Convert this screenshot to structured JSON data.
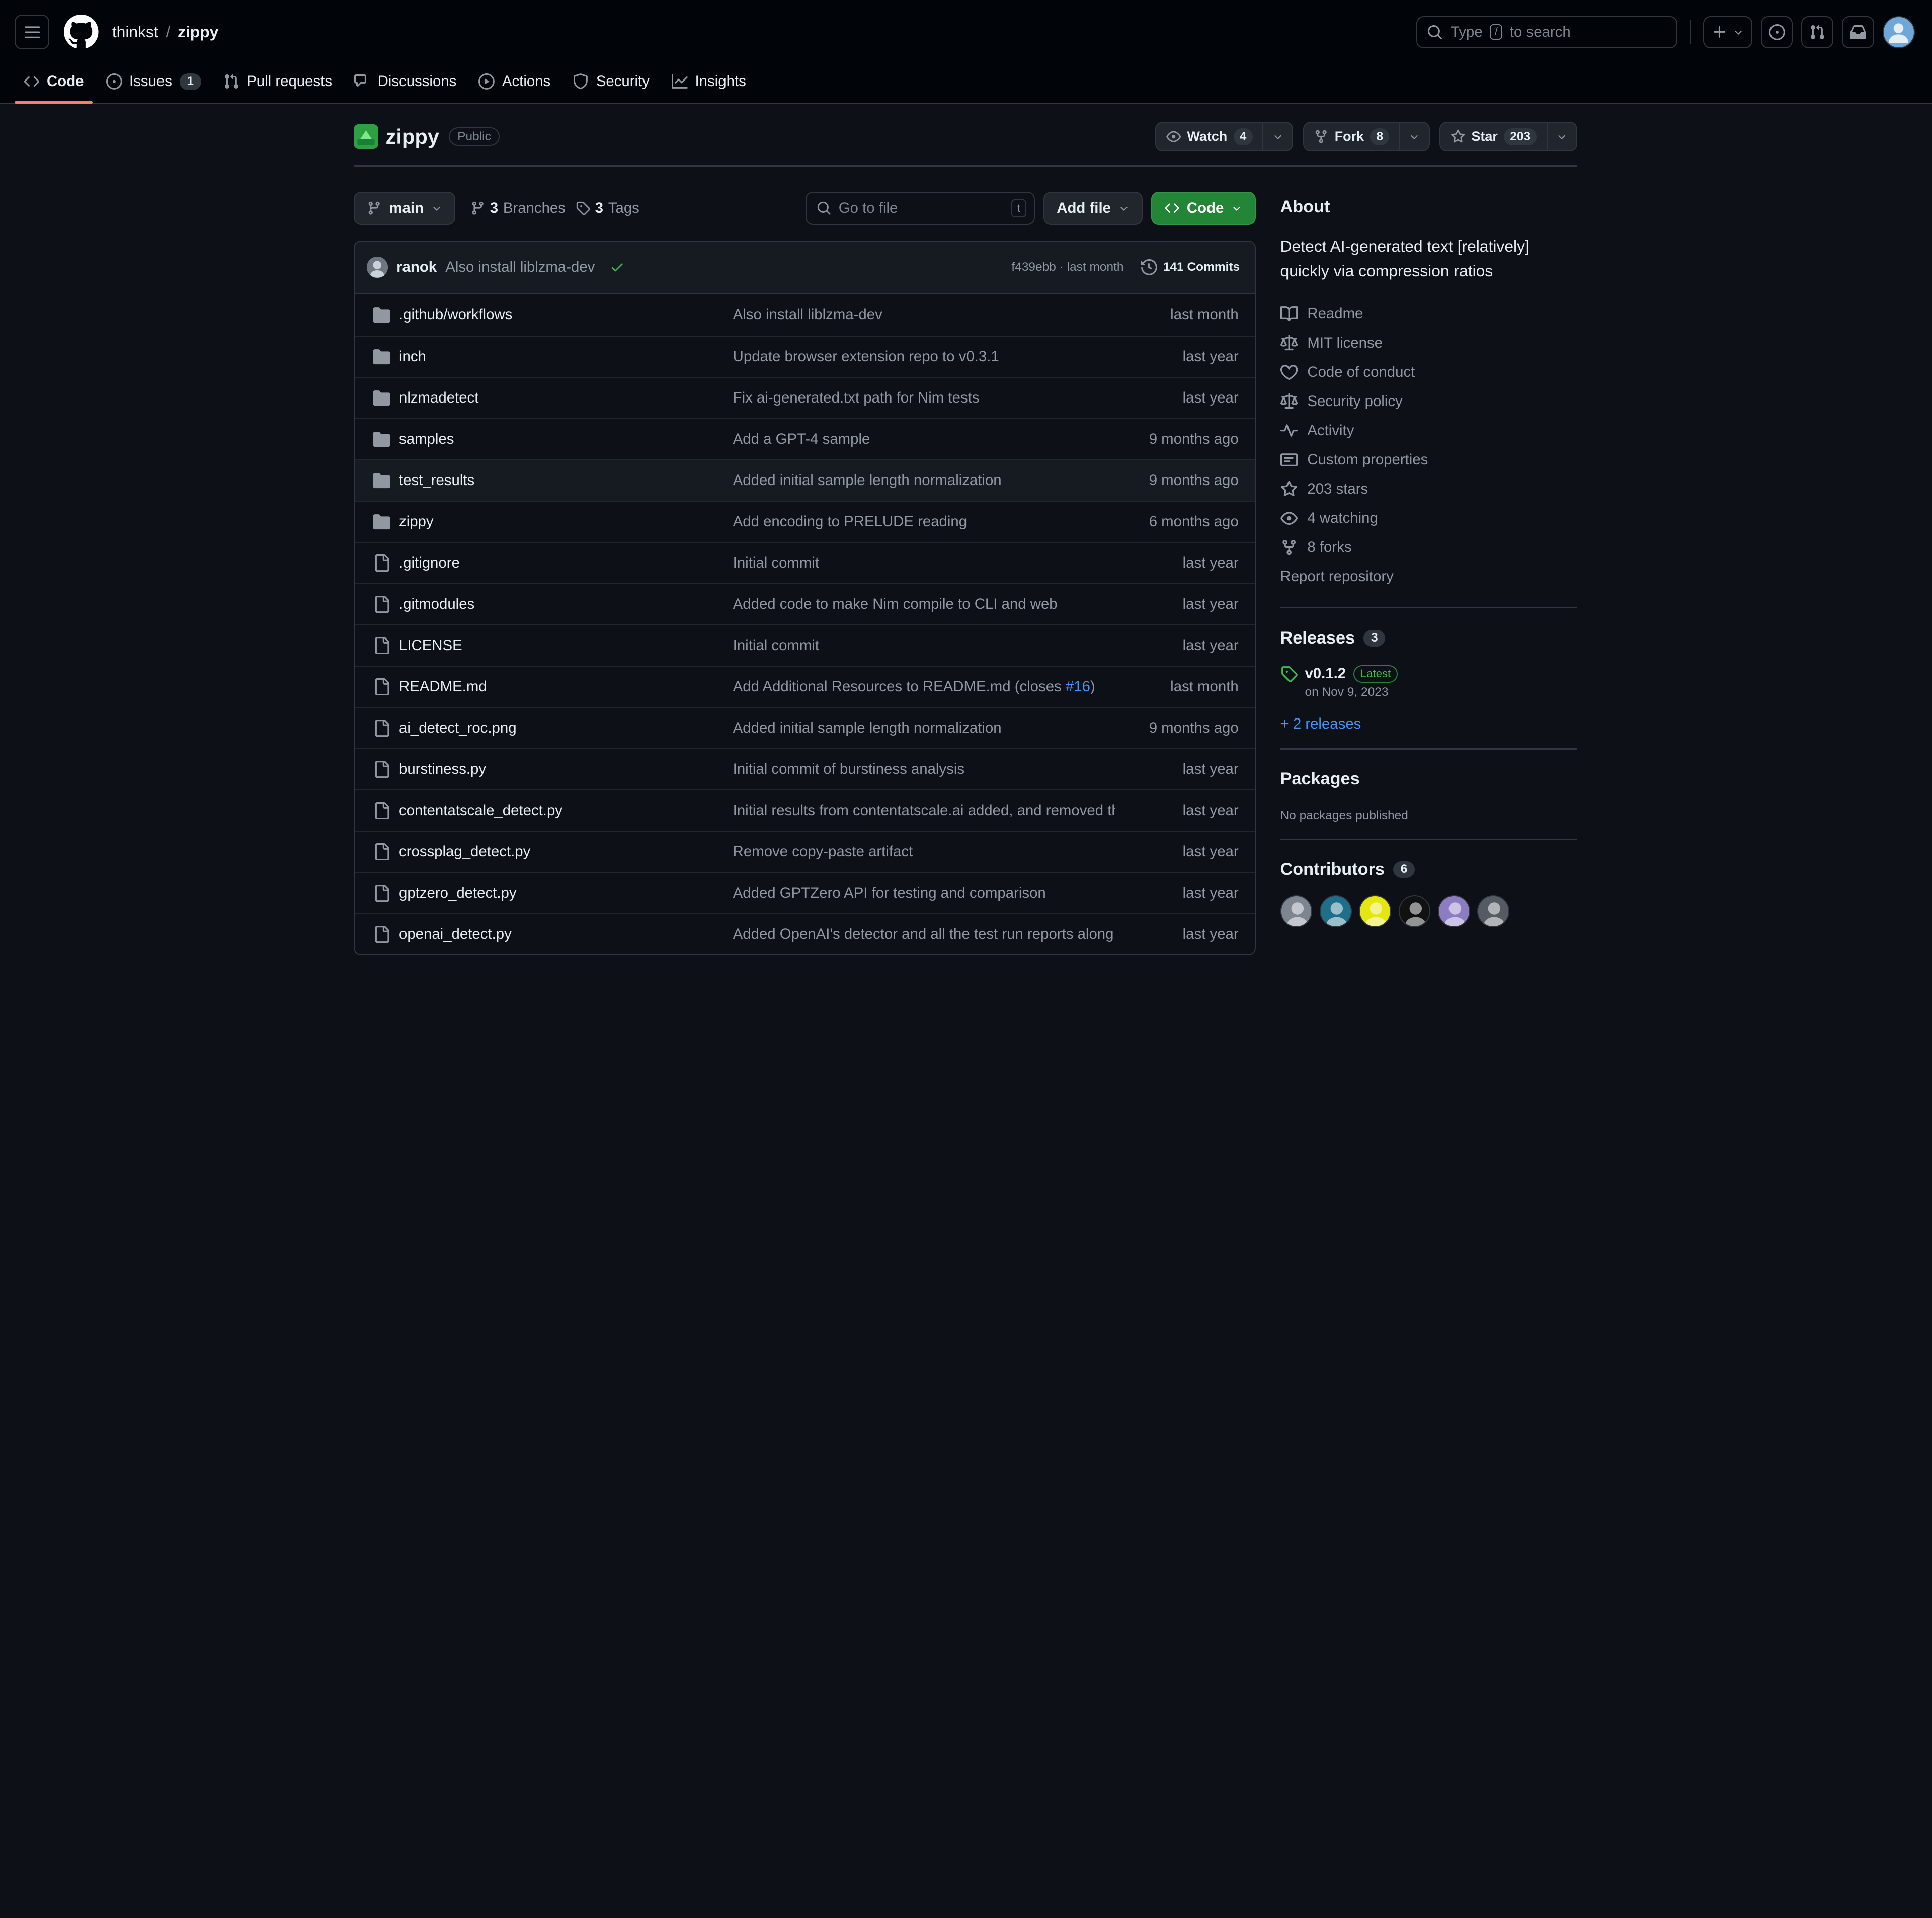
{
  "header": {
    "owner": "thinkst",
    "separator": "/",
    "repo": "zippy",
    "search_pre": "Type",
    "search_key": "/",
    "search_post": "to search"
  },
  "tabs": [
    {
      "label": "Code",
      "icon": "code-icon"
    },
    {
      "label": "Issues",
      "icon": "issue-icon",
      "count": "1"
    },
    {
      "label": "Pull requests",
      "icon": "pull-request-icon"
    },
    {
      "label": "Discussions",
      "icon": "discussions-icon"
    },
    {
      "label": "Actions",
      "icon": "play-icon"
    },
    {
      "label": "Security",
      "icon": "shield-icon"
    },
    {
      "label": "Insights",
      "icon": "graph-icon"
    }
  ],
  "repo": {
    "name": "zippy",
    "visibility": "Public",
    "watch_label": "Watch",
    "watch_count": "4",
    "fork_label": "Fork",
    "fork_count": "8",
    "star_label": "Star",
    "star_count": "203"
  },
  "toolbar": {
    "branch": "main",
    "branches_count": "3",
    "branches_label": "Branches",
    "tags_count": "3",
    "tags_label": "Tags",
    "goto_placeholder": "Go to file",
    "goto_key": "t",
    "add_file": "Add file",
    "code": "Code"
  },
  "latest_commit": {
    "author": "ranok",
    "message": "Also install liblzma-dev",
    "hash_time": "f439ebb · last month",
    "commits": "141 Commits"
  },
  "files": [
    {
      "type": "dir",
      "name": ".github/workflows",
      "message": "Also install liblzma-dev",
      "time": "last month"
    },
    {
      "type": "dir",
      "name": "inch",
      "message": "Update browser extension repo to v0.3.1",
      "time": "last year"
    },
    {
      "type": "dir",
      "name": "nlzmadetect",
      "message": "Fix ai-generated.txt path for Nim tests",
      "time": "last year"
    },
    {
      "type": "dir",
      "name": "samples",
      "message": "Add a GPT-4 sample",
      "time": "9 months ago"
    },
    {
      "type": "dir",
      "name": "test_results",
      "message": "Added initial sample length normalization",
      "time": "9 months ago"
    },
    {
      "type": "dir",
      "name": "zippy",
      "message": "Add encoding to PRELUDE reading",
      "time": "6 months ago"
    },
    {
      "type": "file",
      "name": ".gitignore",
      "message": "Initial commit",
      "time": "last year"
    },
    {
      "type": "file",
      "name": ".gitmodules",
      "message": "Added code to make Nim compile to CLI and web",
      "time": "last year"
    },
    {
      "type": "file",
      "name": "LICENSE",
      "message": "Initial commit",
      "time": "last year"
    },
    {
      "type": "file",
      "name": "README.md",
      "message": "Add Additional Resources to README.md (closes ",
      "message_link": "#16",
      "message_tail": ")",
      "time": "last month"
    },
    {
      "type": "file",
      "name": "ai_detect_roc.png",
      "message": "Added initial sample length normalization",
      "time": "9 months ago"
    },
    {
      "type": "file",
      "name": "burstiness.py",
      "message": "Initial commit of burstiness analysis",
      "time": "last year"
    },
    {
      "type": "file",
      "name": "contentatscale_detect.py",
      "message": "Initial results from contentatscale.ai added, and removed the...",
      "time": "last year"
    },
    {
      "type": "file",
      "name": "crossplag_detect.py",
      "message": "Remove copy-paste artifact",
      "time": "last year"
    },
    {
      "type": "file",
      "name": "gptzero_detect.py",
      "message": "Added GPTZero API for testing and comparison",
      "time": "last year"
    },
    {
      "type": "file",
      "name": "openai_detect.py",
      "message": "Added OpenAI's detector and all the test run reports along ...",
      "time": "last year"
    }
  ],
  "about": {
    "title": "About",
    "description": "Detect AI-generated text [relatively] quickly via compression ratios",
    "items": [
      {
        "icon": "book-icon",
        "label": "Readme"
      },
      {
        "icon": "law-icon",
        "label": "MIT license"
      },
      {
        "icon": "heart-icon",
        "label": "Code of conduct"
      },
      {
        "icon": "law-icon",
        "label": "Security policy"
      },
      {
        "icon": "pulse-icon",
        "label": "Activity"
      },
      {
        "icon": "note-icon",
        "label": "Custom properties"
      },
      {
        "icon": "star-icon",
        "label": "203 stars"
      },
      {
        "icon": "eye-icon",
        "label": "4 watching"
      },
      {
        "icon": "fork-icon",
        "label": "8 forks"
      }
    ],
    "report": "Report repository"
  },
  "releases": {
    "title": "Releases",
    "count": "3",
    "tag": "v0.1.2",
    "latest": "Latest",
    "date": "on Nov 9, 2023",
    "more": "+ 2 releases"
  },
  "packages": {
    "title": "Packages",
    "empty": "No packages published"
  },
  "contributors": {
    "title": "Contributors",
    "count": "6",
    "avatar_colors": [
      "#7d8590",
      "#1f6f8b",
      "#e5e510",
      "#111111",
      "#8e7cc3",
      "#555b63"
    ]
  }
}
